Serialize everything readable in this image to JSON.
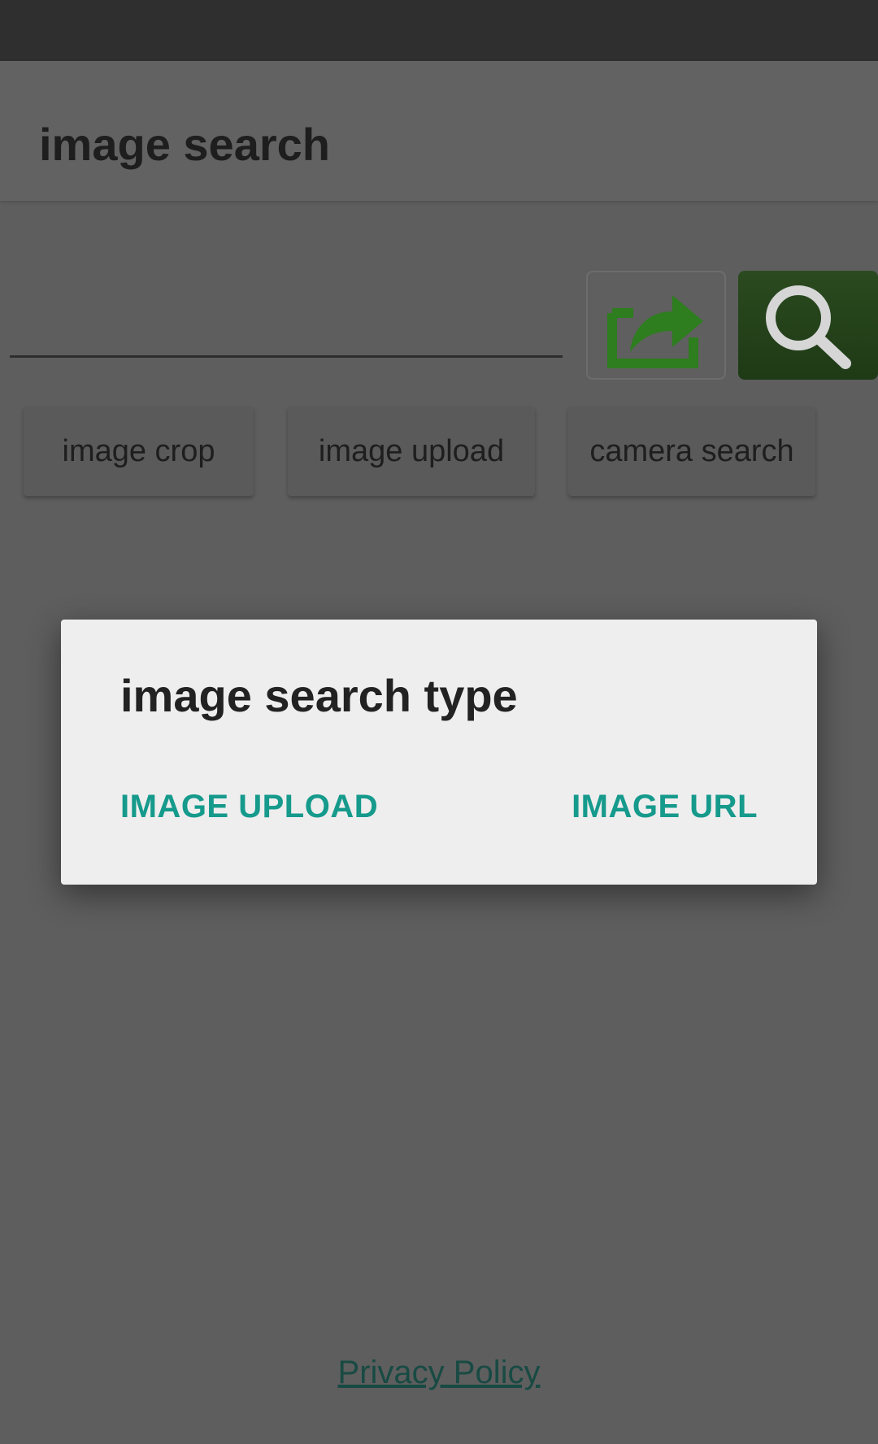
{
  "app": {
    "title": "image search"
  },
  "search": {
    "value": "",
    "placeholder": ""
  },
  "icons": {
    "share": "share-icon",
    "search": "magnifier-icon"
  },
  "chips": {
    "crop": "image crop",
    "upload": "image upload",
    "camera": "camera search"
  },
  "dialog": {
    "title": "image search type",
    "action_upload": "IMAGE UPLOAD",
    "action_url": "IMAGE URL"
  },
  "footer": {
    "privacy": "Privacy Policy"
  },
  "colors": {
    "accent": "#159a8c",
    "brand_green": "#2e7d1e",
    "search_button": "#24421a"
  }
}
